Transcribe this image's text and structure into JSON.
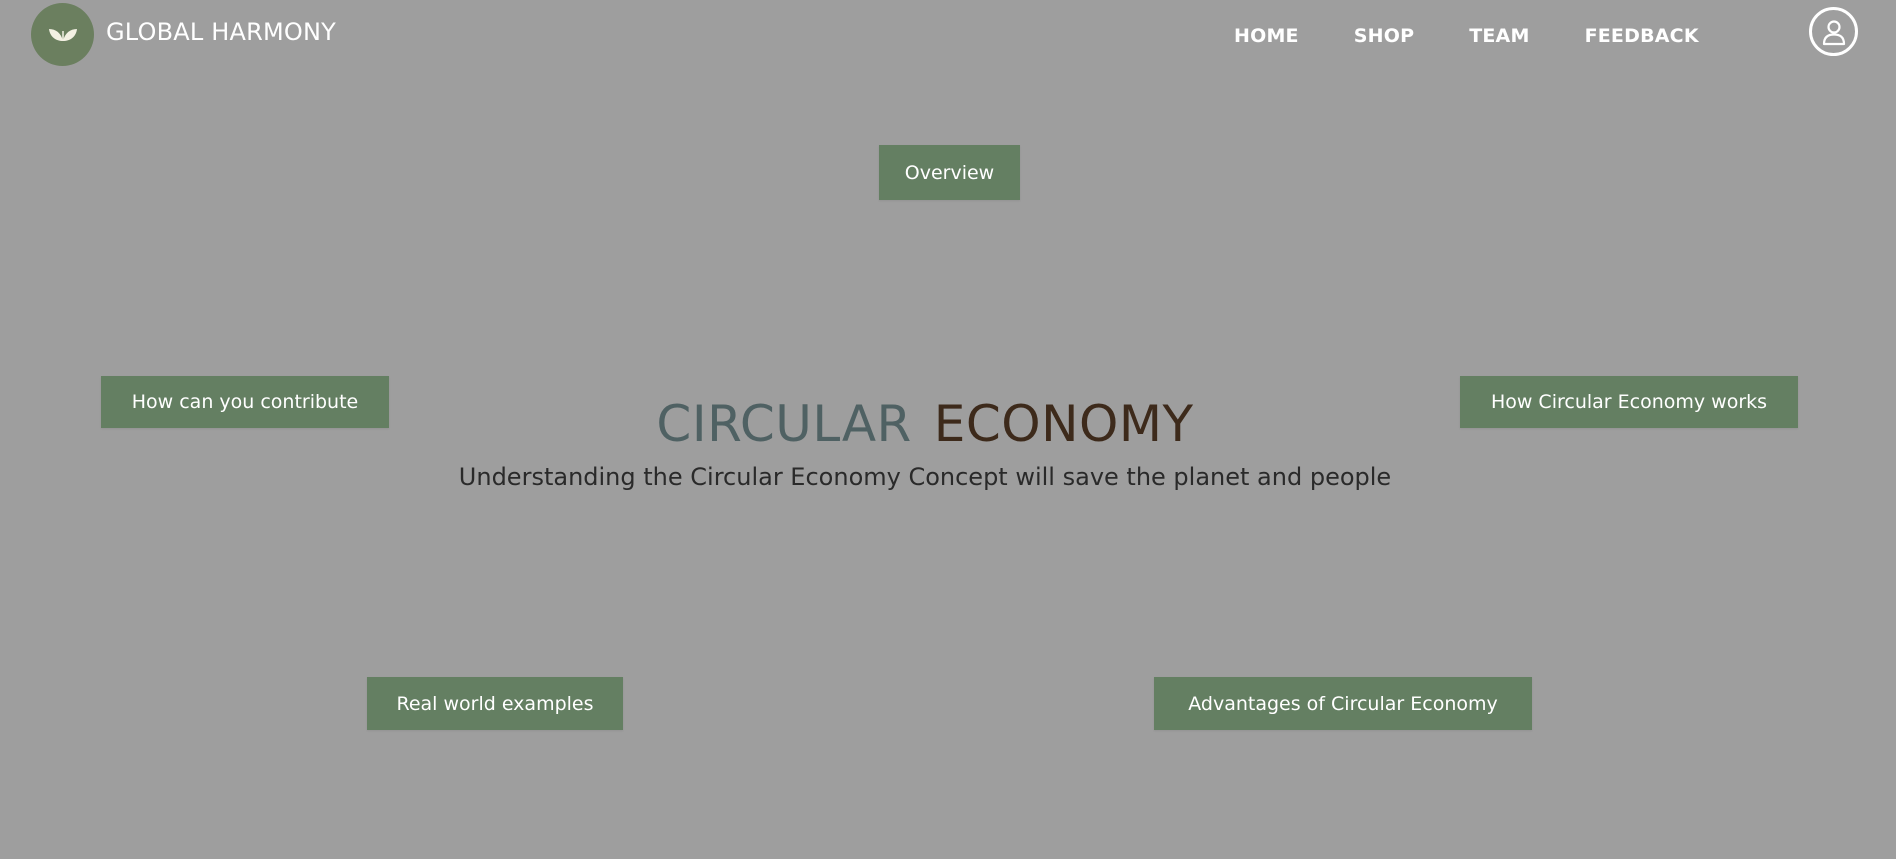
{
  "header": {
    "brand": "GLOBAL HARMONY",
    "logo_icon": "leaf-icon",
    "nav": [
      {
        "label": "HOME"
      },
      {
        "label": "SHOP"
      },
      {
        "label": "TEAM"
      },
      {
        "label": "FEEDBACK"
      }
    ],
    "profile_icon": "user-icon"
  },
  "hero": {
    "title_part1": "CIRCULAR",
    "title_part2": "ECONOMY",
    "subtitle": "Understanding the Circular Economy Concept will save the planet and people"
  },
  "topics": {
    "overview": "Overview",
    "contribute": "How can you contribute",
    "works": "How Circular Economy works",
    "examples": "Real world examples",
    "advantages": "Advantages of Circular Economy"
  },
  "colors": {
    "background": "#9e9e9e",
    "button": "#647f62",
    "title_part1": "#4f6163",
    "title_part2": "#3d2a1b",
    "logo_bg": "#6b7f5f"
  }
}
